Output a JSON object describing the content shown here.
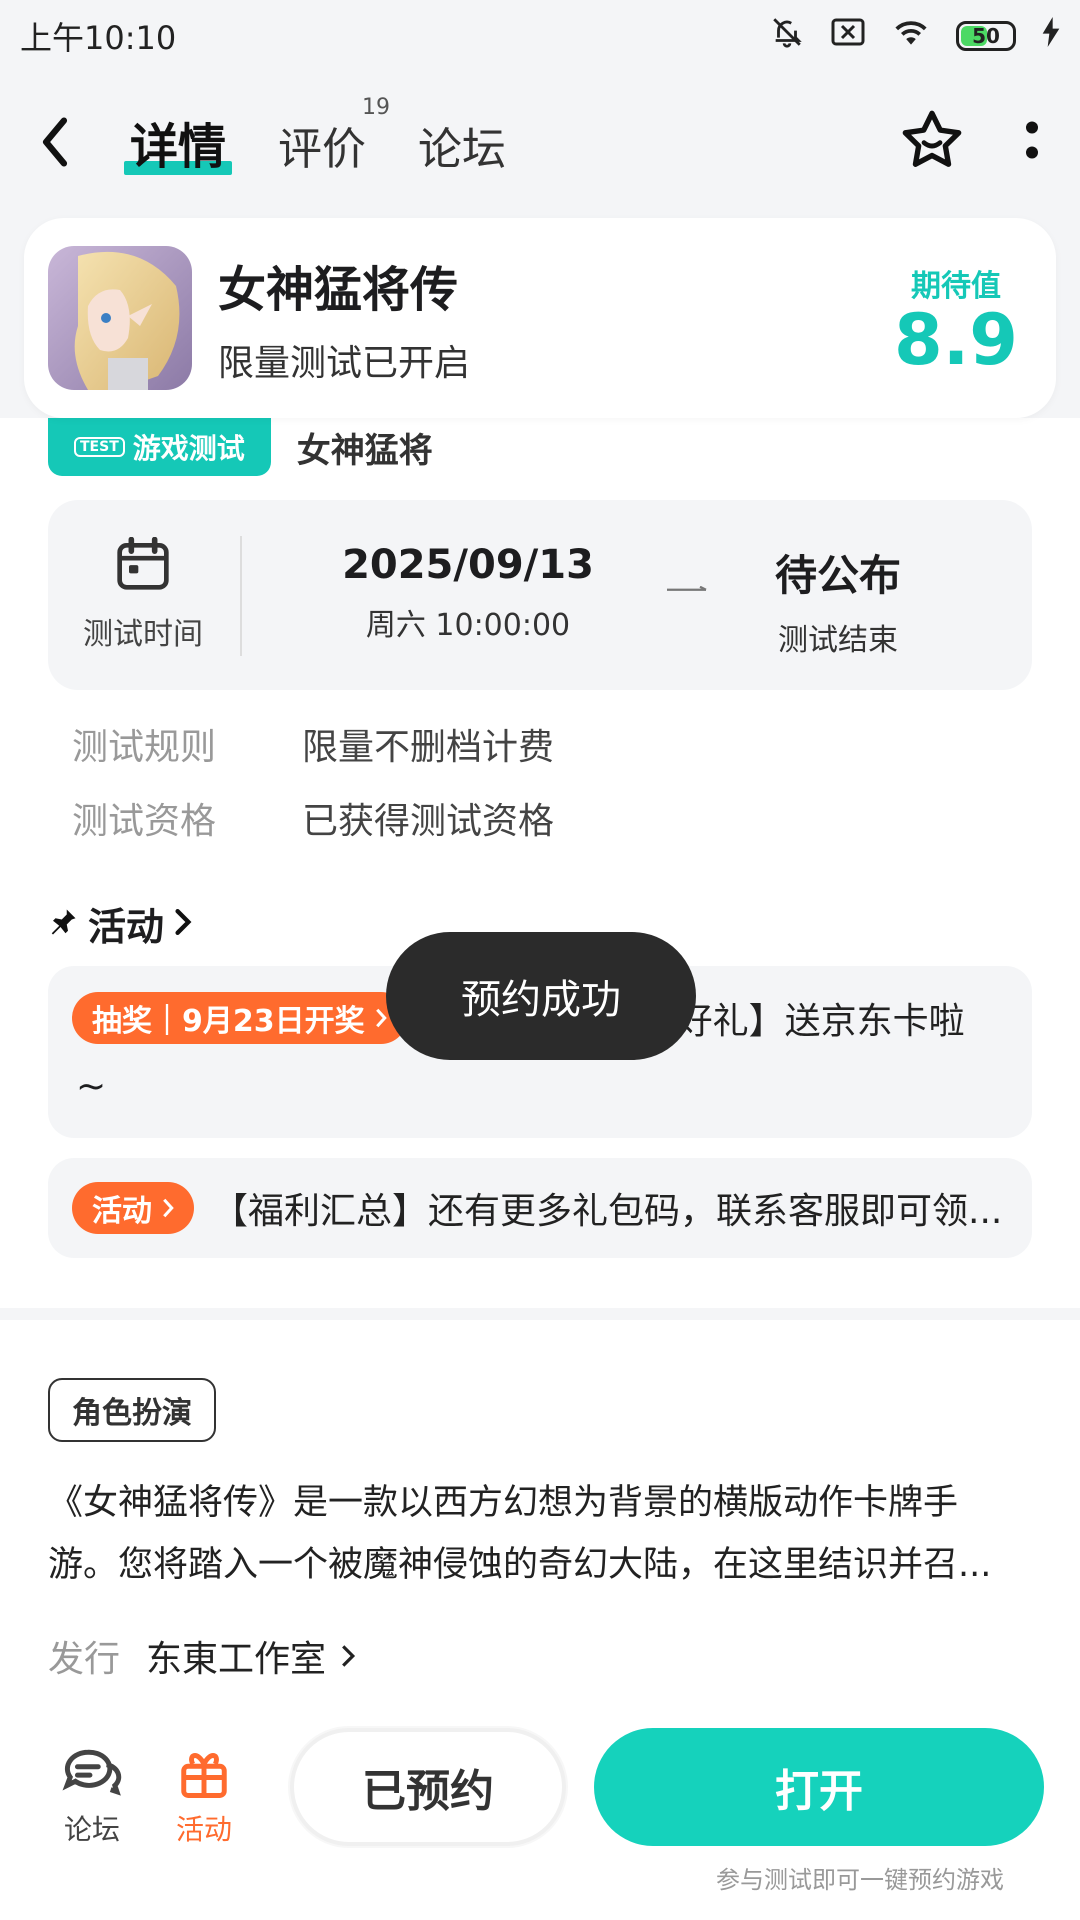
{
  "status_bar": {
    "time": "上午10:10",
    "battery": "50"
  },
  "nav": {
    "tabs": [
      {
        "label": "详情",
        "active": true
      },
      {
        "label": "评价",
        "badge": "19"
      },
      {
        "label": "论坛"
      }
    ]
  },
  "header": {
    "title": "女神猛将传",
    "subtitle": "限量测试已开启",
    "score_label": "期待值",
    "score": "8.9"
  },
  "test": {
    "tag": "游戏测试",
    "tag_icon_text": "TEST",
    "name": "女神猛将",
    "time_label": "测试时间",
    "start_date": "2025/09/13",
    "start_time": "周六  10:00:00",
    "end_value": "待公布",
    "end_label": "测试结束",
    "rules": [
      {
        "key": "测试规则",
        "value": "限量不删档计费"
      },
      {
        "key": "测试资格",
        "value": "已获得测试资格"
      }
    ]
  },
  "activities": {
    "title": "活动",
    "items": [
      {
        "pill": "抽奖｜9月23日开奖",
        "text": "服好礼】送京东卡啦",
        "tail": "~"
      },
      {
        "pill": "活动",
        "text": "【福利汇总】还有更多礼包码，联系客服即可领..."
      }
    ]
  },
  "toast": "预约成功",
  "intro": {
    "genre": "角色扮演",
    "description": "《女神猛将传》是一款以西方幻想为背景的横版动作卡牌手游。您将踏入一个被魔神侵蚀的奇幻大陆，在这里结识并召...",
    "publisher_label": "发行",
    "publisher": "东東工作室"
  },
  "bottom": {
    "forum": "论坛",
    "activity": "活动",
    "reserved": "已预约",
    "open": "打开",
    "hint": "参与测试即可一键预约游戏"
  },
  "colors": {
    "accent": "#15c8b7",
    "orange": "#ff6b2e",
    "toast_bg": "#2b2b2b"
  }
}
